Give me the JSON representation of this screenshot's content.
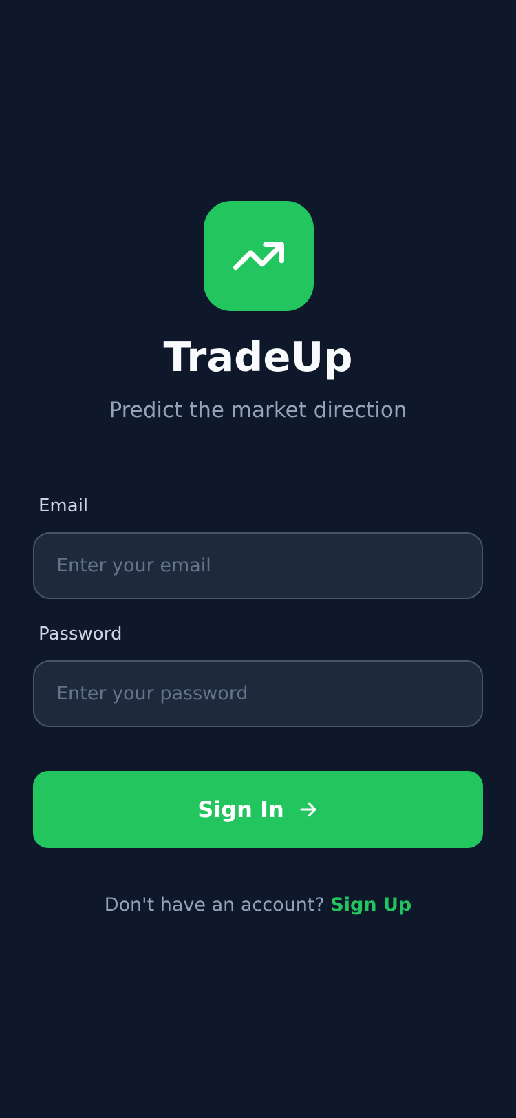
{
  "app": {
    "name": "TradeUp",
    "tagline": "Predict the market direction",
    "logo_icon": "trending-up-icon"
  },
  "form": {
    "email": {
      "label": "Email",
      "placeholder": "Enter your email",
      "value": ""
    },
    "password": {
      "label": "Password",
      "placeholder": "Enter your password",
      "value": ""
    },
    "submit": {
      "label": "Sign In",
      "icon": "arrow-right-icon"
    }
  },
  "footer": {
    "prompt": "Don't have an account?",
    "link_label": "Sign Up"
  },
  "colors": {
    "background": "#0f172a",
    "accent": "#22c55e",
    "input_bg": "#1e293b",
    "input_border": "#475569",
    "muted_text": "#94a3b8"
  }
}
